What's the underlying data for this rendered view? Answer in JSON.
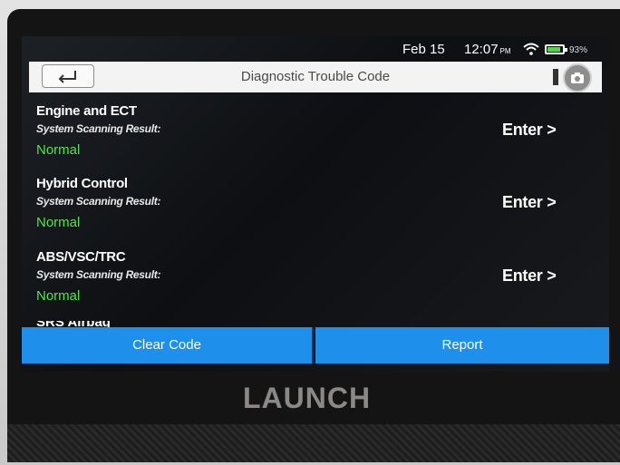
{
  "status_bar": {
    "date": "Feb 15",
    "time": "12:07",
    "ampm": "PM",
    "battery_percent": "93%"
  },
  "header": {
    "title": "Diagnostic Trouble Code"
  },
  "systems": [
    {
      "name": "Engine and ECT",
      "label": "System Scanning Result:",
      "status": "Normal",
      "action": "Enter >"
    },
    {
      "name": "Hybrid Control",
      "label": "System Scanning Result:",
      "status": "Normal",
      "action": "Enter >"
    },
    {
      "name": "ABS/VSC/TRC",
      "label": "System Scanning Result:",
      "status": "Normal",
      "action": "Enter >"
    }
  ],
  "partial_item": {
    "name": "SRS Airbag"
  },
  "actions": {
    "clear_code": "Clear Code",
    "report": "Report"
  },
  "brand": {
    "logo_text": "LAUNCH"
  },
  "colors": {
    "normal_status": "#53e44b",
    "action_button": "#1e8fea",
    "title_bar": "#f3f3f3"
  }
}
